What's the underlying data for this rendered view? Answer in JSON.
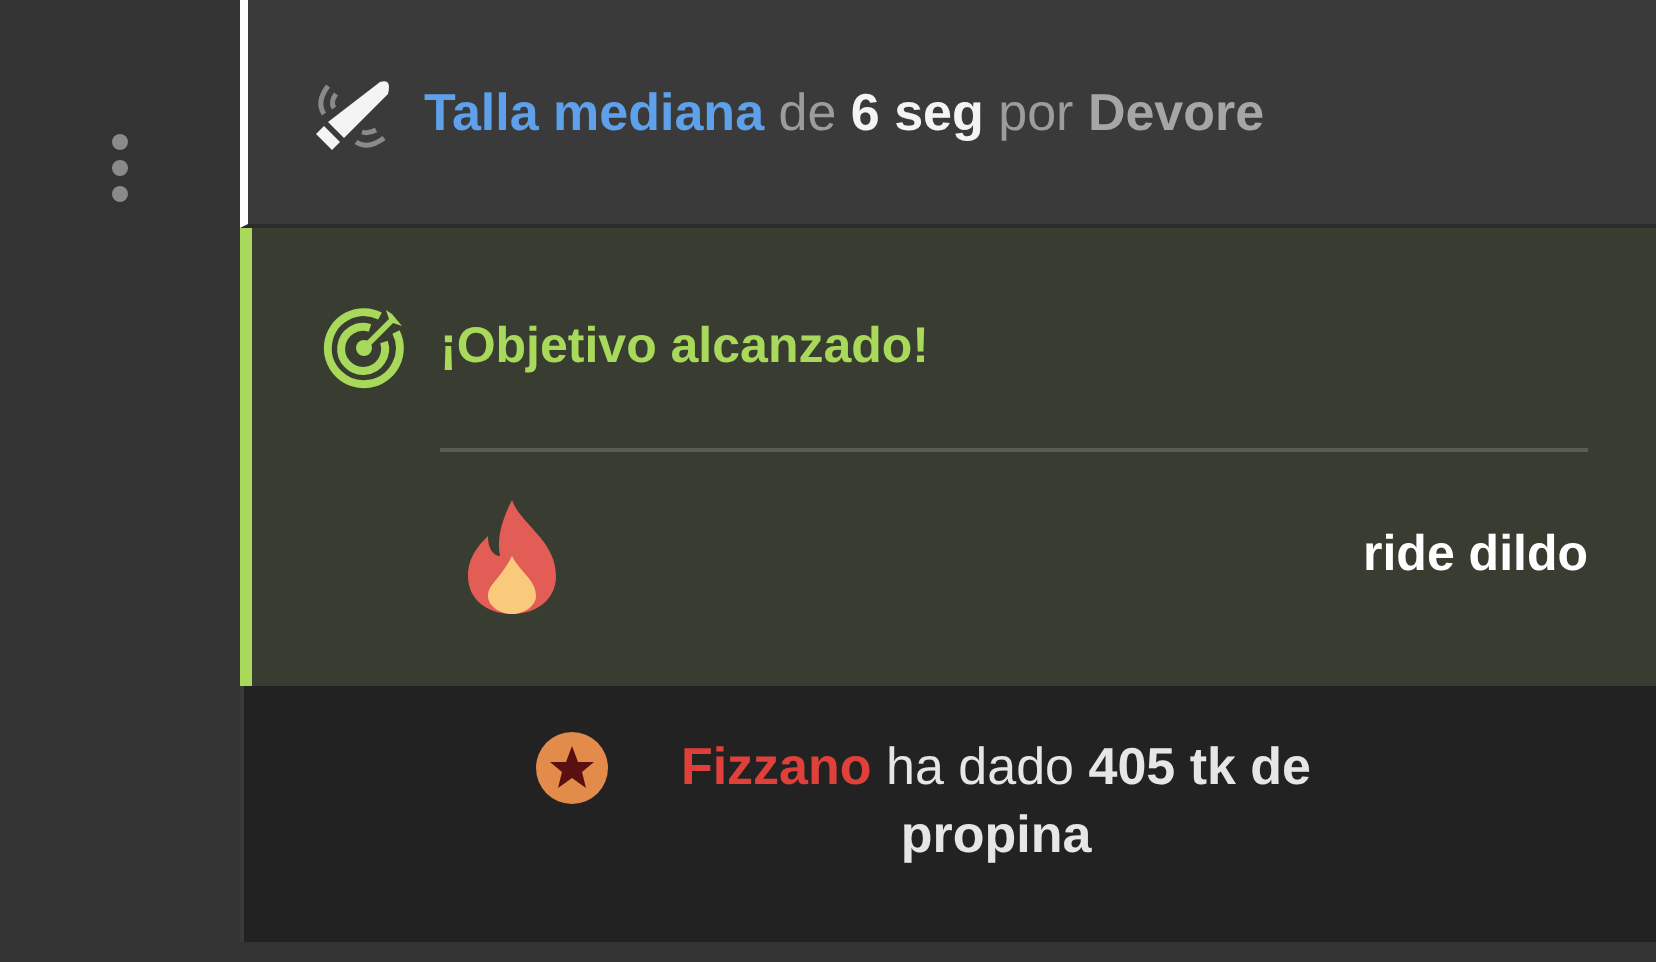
{
  "lovense_message": {
    "text": "**Talla mediana** de **6 seg** por **Devore**"
  },
  "goal": {
    "title": "¡Objetivo alcanzado!",
    "reward": "ride dildo"
  },
  "tip_message": {
    "text": "**Fizzano** ha dado **405 tk de propina**"
  }
}
